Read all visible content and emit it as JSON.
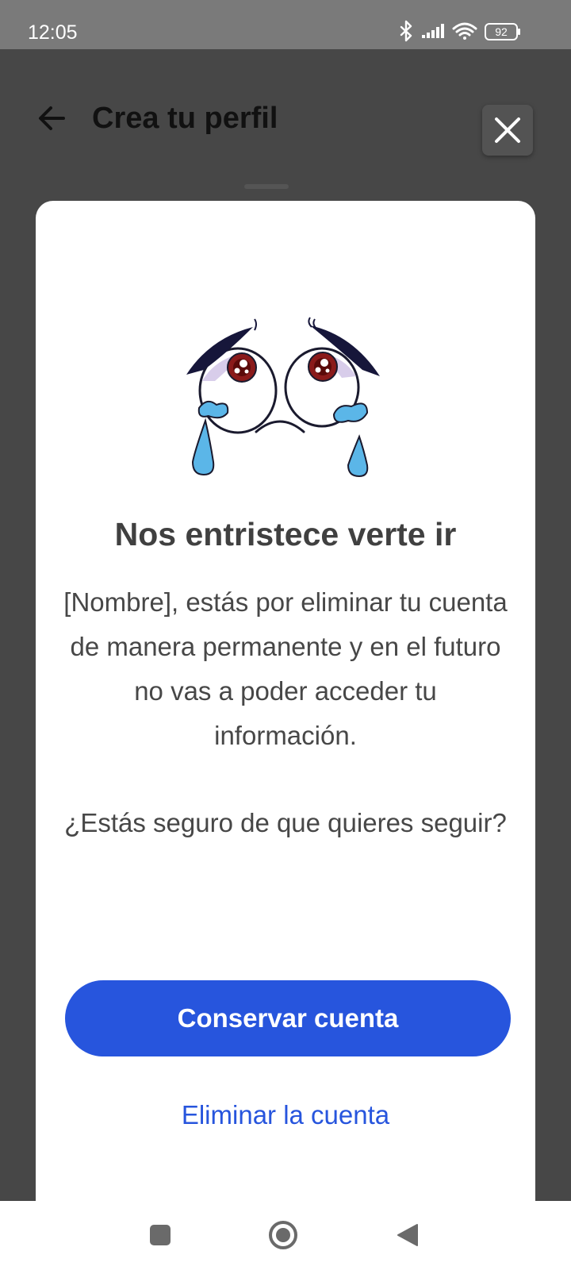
{
  "status_bar": {
    "time": "12:05",
    "battery": "92",
    "icons": [
      "bluetooth-icon",
      "signal-icon",
      "wifi-icon",
      "battery-icon"
    ]
  },
  "header": {
    "title": "Crea tu perfil",
    "back_icon": "arrow-left-icon",
    "close_icon": "close-icon"
  },
  "dialog": {
    "illustration": "crying-face-illustration",
    "title": "Nos entristece verte ir",
    "body": "[Nombre], estás por eliminar tu cuenta de manera permanente y en el futuro no vas a poder acceder tu información.",
    "question": "¿Estás seguro de que quieres seguir?",
    "primary_button": "Conservar cuenta",
    "secondary_link": "Eliminar la cuenta"
  },
  "colors": {
    "accent": "#2755dd",
    "overlay": "#474747",
    "status_bar": "#7a7a7a",
    "tear": "#5bb6e8"
  },
  "nav_bar": {
    "icons": [
      "recents-icon",
      "home-icon",
      "back-icon"
    ]
  }
}
